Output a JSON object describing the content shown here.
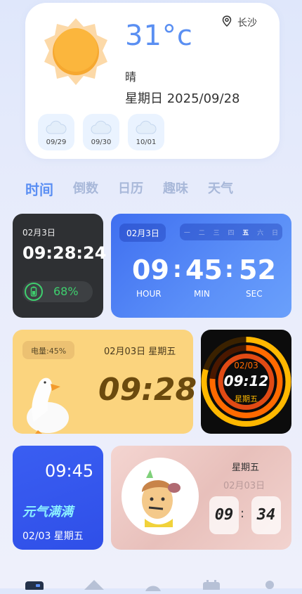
{
  "weather": {
    "temperature": "31°c",
    "location": "长沙",
    "condition": "晴",
    "date": "星期日 2025/09/28",
    "forecast": [
      {
        "date": "09/29",
        "icon": "cloud-icon"
      },
      {
        "date": "09/30",
        "icon": "cloud-icon"
      },
      {
        "date": "10/01",
        "icon": "cloud-icon"
      }
    ]
  },
  "tabs": [
    {
      "label": "时间",
      "active": true
    },
    {
      "label": "倒数",
      "active": false
    },
    {
      "label": "日历",
      "active": false
    },
    {
      "label": "趣味",
      "active": false
    },
    {
      "label": "天气",
      "active": false
    }
  ],
  "widgets": {
    "dark_clock": {
      "date": "02月3日",
      "time": "09:28:24",
      "battery": "68%"
    },
    "blue_clock": {
      "date": "02月3日",
      "weekdays": [
        "一",
        "二",
        "三",
        "四",
        "五",
        "六",
        "日"
      ],
      "active_weekday": "五",
      "hour": "09",
      "minute": "45",
      "second": "52",
      "hour_label": "HOUR",
      "min_label": "MIN",
      "sec_label": "SEC",
      "sep": ":"
    },
    "duck_clock": {
      "battery": "电量:45%",
      "date": "02月03日 星期五",
      "time": "09:28"
    },
    "ring_clock": {
      "date": "02/03",
      "time": "09:12",
      "weekday": "星期五"
    },
    "blue_small": {
      "time": "09:45",
      "slogan": "元气满满",
      "date": "02/03 星期五"
    },
    "pink_clock": {
      "weekday": "星期五",
      "date": "02月03日",
      "hour": "09",
      "minute": "34",
      "sep": ":"
    }
  },
  "colors": {
    "accent": "#5b8ff3",
    "tab_inactive": "#a8b8d9",
    "battery_green": "#3ecf6e",
    "ring_orange": "#ff6a00"
  }
}
